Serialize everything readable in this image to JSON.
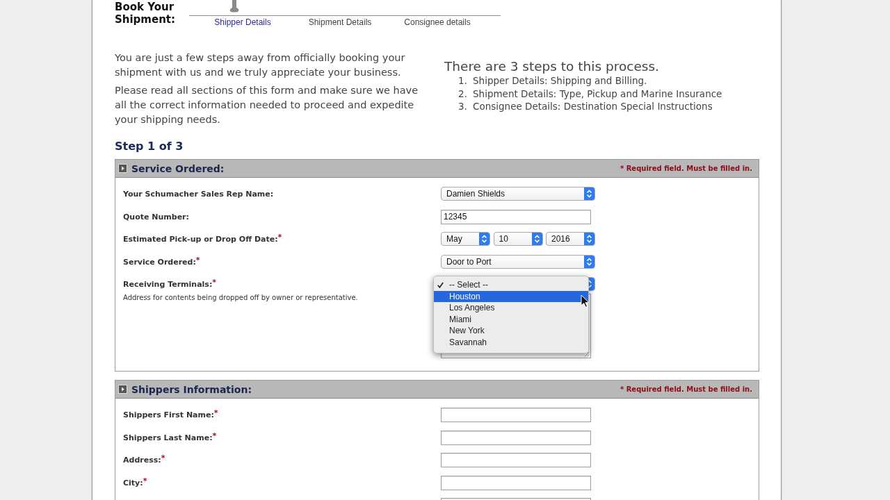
{
  "header": {
    "title": "Book Your Shipment:",
    "steps": [
      {
        "label": "Shipper Details",
        "selected": true
      },
      {
        "label": "Shipment Details",
        "selected": false
      },
      {
        "label": "Consignee details",
        "selected": false
      }
    ]
  },
  "intro": {
    "paragraphs": [
      "You are just a few steps away from officially booking your shipment with us and we truly appreciate your business.",
      "Please read all sections of this form and make sure we have all the correct information needed to proceed and expedite your shipping needs."
    ],
    "steps_heading": "There are 3 steps to this process.",
    "steps": [
      {
        "number": "1.",
        "text": "Shipper Details: Shipping and Billing."
      },
      {
        "number": "2.",
        "text": "Shipment Details: Type, Pickup and Marine Insurance"
      },
      {
        "number": "3.",
        "text": "Consignee Details: Destination Special Instructions"
      }
    ]
  },
  "step_title": "Step 1 of 3",
  "sections": [
    {
      "title": "Service Ordered:",
      "required_note": "* Required field. Must be filled in.",
      "fields": [
        {
          "kind": "select",
          "label": "Your Schumacher Sales Rep Name:",
          "value": "Damien Shields"
        },
        {
          "kind": "text",
          "label": "Quote Number:",
          "value": "12345"
        },
        {
          "kind": "date",
          "label": "Estimated Pick-up or Drop Off Date:$^{*}$",
          "parts": [
            "May",
            "10",
            "2016"
          ]
        },
        {
          "kind": "select",
          "label": "Service Ordered:$^{*}$",
          "value": "Door to Port"
        },
        {
          "kind": "select_textarea",
          "label": "Receiving Terminals:$^{*}$",
          "hint": "Address for contents being dropped off by owner or representative.",
          "open": true,
          "options": [
            {
              "label": "-- Select --",
              "selected": true,
              "highlighted": false
            },
            {
              "label": "Houston",
              "selected": false,
              "highlighted": true
            },
            {
              "label": "Los Angeles",
              "selected": false,
              "highlighted": false
            },
            {
              "label": "Miami",
              "selected": false,
              "highlighted": false
            },
            {
              "label": "New York",
              "selected": false,
              "highlighted": false
            },
            {
              "label": "Savannah",
              "selected": false,
              "highlighted": false
            }
          ]
        }
      ]
    },
    {
      "title": "Shippers Information:",
      "required_note": "* Required field. Must be filled in.",
      "fields": [
        {
          "kind": "text",
          "label": "Shippers First Name:$^{*}$"
        },
        {
          "kind": "text",
          "label": "Shippers Last Name:$^{*}$"
        },
        {
          "kind": "text",
          "label": "Address:$^{*}$"
        },
        {
          "kind": "text",
          "label": "City:$^{*}$"
        },
        {
          "kind": "text"
        }
      ]
    }
  ]
}
